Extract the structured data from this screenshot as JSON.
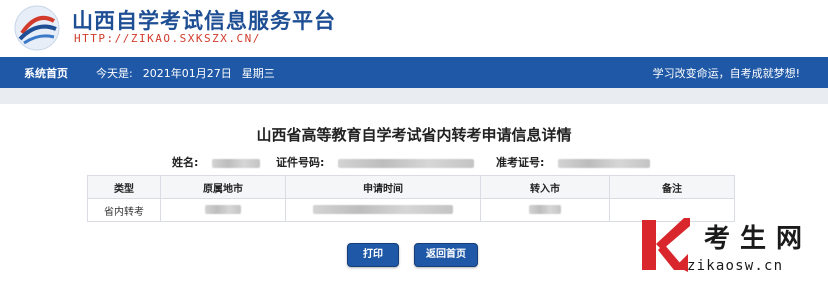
{
  "header": {
    "site_title": "山西自学考试信息服务平台",
    "site_url": "HTTP://ZIKAO.SXKSZX.CN/"
  },
  "nav": {
    "home": "系统首页",
    "date_label": "今天是:",
    "date": "2021年01月27日",
    "weekday": "星期三",
    "slogan": "学习改变命运，自考成就梦想!"
  },
  "page": {
    "title": "山西省高等教育自学考试省内转考申请信息详情",
    "name_label": "姓名:",
    "id_label": "证件号码:",
    "ticket_label": "准考证号:"
  },
  "table": {
    "headers": [
      "类型",
      "原属地市",
      "申请时间",
      "转入市",
      "备注"
    ],
    "row_type": "省内转考"
  },
  "buttons": {
    "print": "打印",
    "back": "返回首页"
  },
  "watermark": {
    "cn": "考生网",
    "url": "zikaosw.cn"
  },
  "colors": {
    "nav_blue": "#1f58a6",
    "title_blue": "#1e4e94",
    "url_red": "#d23b2b",
    "watermark_red": "#d8262c"
  }
}
